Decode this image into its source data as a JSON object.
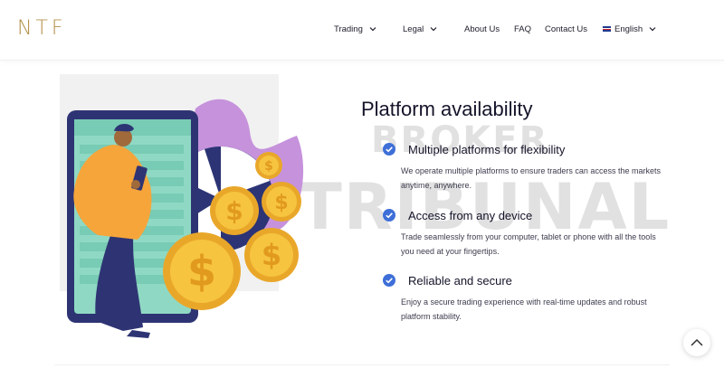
{
  "header": {
    "logo": "NTF",
    "nav": [
      {
        "label": "Trading",
        "has_dropdown": true
      },
      {
        "label": "Legal",
        "has_dropdown": true
      },
      {
        "label": "About Us",
        "has_dropdown": false
      },
      {
        "label": "FAQ",
        "has_dropdown": false
      },
      {
        "label": "Contact Us",
        "has_dropdown": false
      }
    ],
    "language": {
      "label": "English",
      "flag_icon": "uk-flag-icon"
    }
  },
  "watermark": {
    "line1": "BROKER",
    "line2": "TRIBUNAL"
  },
  "section": {
    "title": "Platform availability",
    "features": [
      {
        "title": "Multiple platforms for flexibility",
        "description_line1": "We operate multiple platforms to ensure traders can access the markets",
        "description_line2": "anytime, anywhere.",
        "icon": "check-circle-icon"
      },
      {
        "title": "Access from any device",
        "description_line1": "Trade seamlessly from your computer, tablet or phone with all the tools",
        "description_line2": "you need at your fingertips.",
        "icon": "check-circle-icon"
      },
      {
        "title": "Reliable and secure",
        "description_line1": "Enjoy a secure trading experience with real-time updates and robust",
        "description_line2": "platform stability.",
        "icon": "check-circle-icon"
      }
    ]
  },
  "colors": {
    "brand": "#b4904c",
    "accent": "#3e6fd8",
    "coin": "#f3b92a",
    "phone": "#2e3473"
  },
  "scroll_top_icon": "chevron-up-icon"
}
